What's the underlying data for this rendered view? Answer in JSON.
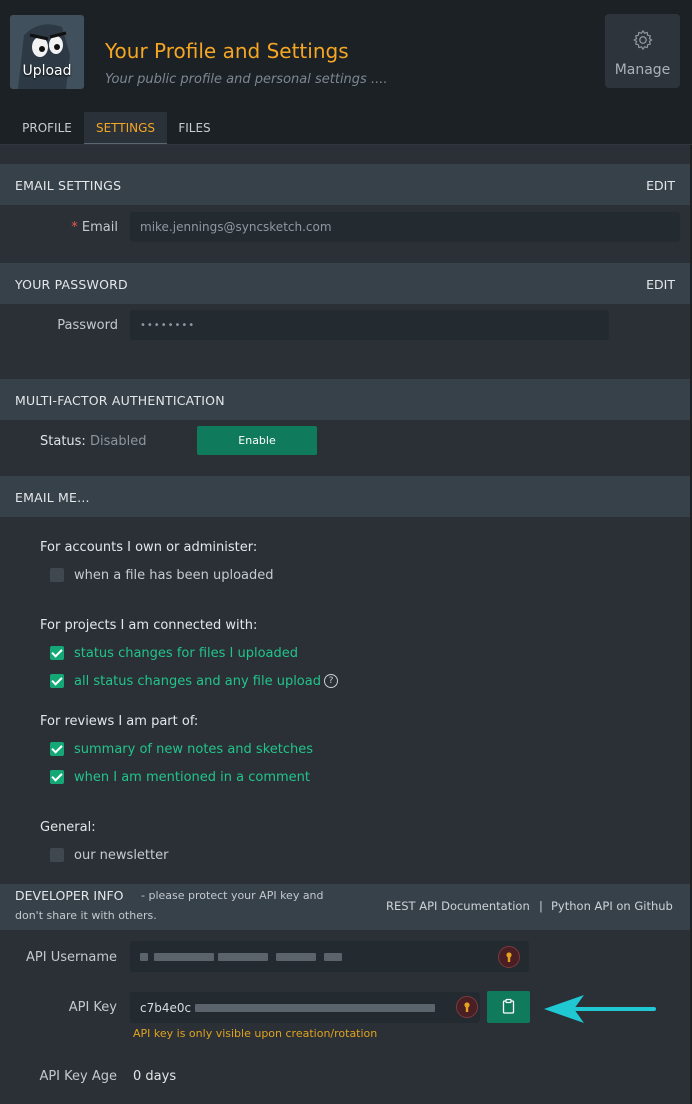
{
  "header": {
    "avatar_label": "Upload",
    "title": "Your Profile and Settings",
    "subtitle": "Your public profile and personal settings ....",
    "manage_label": "Manage",
    "manage_icon": "gear-icon"
  },
  "tabs": [
    {
      "label": "PROFILE",
      "active": false
    },
    {
      "label": "SETTINGS",
      "active": true
    },
    {
      "label": "FILES",
      "active": false
    }
  ],
  "email_settings": {
    "heading": "EMAIL SETTINGS",
    "edit_label": "EDIT",
    "required_mark": "*",
    "email_label": "Email",
    "email_value": "mike.jennings@syncsketch.com"
  },
  "password": {
    "heading": "YOUR PASSWORD",
    "edit_label": "EDIT",
    "label": "Password",
    "value": "••••••••"
  },
  "mfa": {
    "heading": "MULTI-FACTOR AUTHENTICATION",
    "status_label": "Status:",
    "status_value": "Disabled",
    "enable_label": "Enable"
  },
  "email_me": {
    "heading": "EMAIL ME...",
    "groups": [
      {
        "title": "For accounts I own or administer:",
        "options": [
          {
            "label": "when a file has been uploaded",
            "checked": false
          }
        ]
      },
      {
        "title": "For projects I am connected with:",
        "options": [
          {
            "label": "status changes for files I uploaded",
            "checked": true
          },
          {
            "label": "all status changes and any file upload",
            "checked": true
          }
        ]
      },
      {
        "title": "For reviews I am part of:",
        "options": [
          {
            "label": "summary of new notes and sketches",
            "checked": true
          },
          {
            "label": "when I am mentioned in a comment",
            "checked": true
          }
        ]
      },
      {
        "title": "General:",
        "options": [
          {
            "label": "our newsletter",
            "checked": false
          }
        ]
      }
    ],
    "help_glyph": "?"
  },
  "developer": {
    "heading": "DEVELOPER INFO",
    "note_line1": "- please protect your API key and",
    "note_line2": "don't share it with others.",
    "rest_link": "REST API Documentation",
    "separator": "|",
    "python_link": "Python API on Github",
    "api_username_label": "API Username",
    "api_key_label": "API Key",
    "api_key_prefix": "c7b4e0c",
    "api_key_warning": "API key is only visible upon creation/rotation",
    "api_key_age_label": "API Key Age",
    "api_key_age_value": "0 days"
  },
  "colors": {
    "accent": "#f5a623",
    "green": "#0f7a5c",
    "check_green": "#14a877",
    "arrow": "#1fc8d3"
  }
}
